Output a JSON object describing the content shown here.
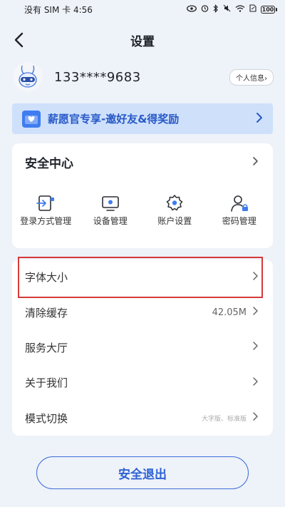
{
  "status_bar": {
    "carrier": "没有 SIM 卡 4:56",
    "battery": "100"
  },
  "nav": {
    "title": "设置",
    "back_icon": "chevron-left-icon"
  },
  "profile": {
    "phone": "133****9683",
    "info_button": "个人信息›"
  },
  "promo": {
    "text": "薪愿官专享-邀好友&得奖励",
    "icon": "mail-heart-icon"
  },
  "security": {
    "title": "安全中心",
    "items": [
      {
        "label": "登录方式管理",
        "icon": "login-method-icon"
      },
      {
        "label": "设备管理",
        "icon": "device-icon"
      },
      {
        "label": "账户设置",
        "icon": "account-settings-icon"
      },
      {
        "label": "密码管理",
        "icon": "password-icon"
      }
    ]
  },
  "settings_list": [
    {
      "label": "字体大小",
      "value": ""
    },
    {
      "label": "清除缓存",
      "value": "42.05M"
    },
    {
      "label": "服务大厅",
      "value": ""
    },
    {
      "label": "关于我们",
      "value": ""
    },
    {
      "label": "模式切换",
      "value": "大字版、标准版"
    }
  ],
  "logout": {
    "label": "安全退出"
  },
  "colors": {
    "accent": "#2d62d6",
    "promo_bg": "#cfe0fb",
    "highlight": "#d63a3a",
    "page_bg": "#eef2f9"
  }
}
